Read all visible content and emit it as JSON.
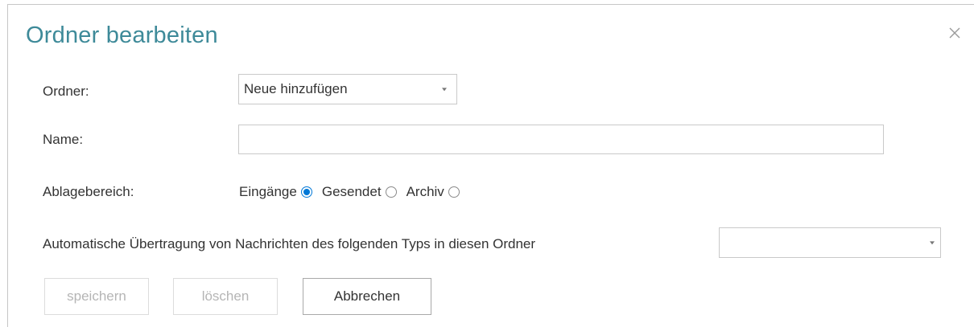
{
  "dialog": {
    "title": "Ordner bearbeiten",
    "close_icon": "close-icon"
  },
  "form": {
    "folder_label": "Ordner:",
    "folder_value": "Neue hinzufügen",
    "name_label": "Name:",
    "name_value": "",
    "area_label": "Ablagebereich:",
    "area_options": [
      {
        "label": "Eingänge",
        "checked": true
      },
      {
        "label": "Gesendet",
        "checked": false
      },
      {
        "label": "Archiv",
        "checked": false
      }
    ],
    "auto_transfer_label": "Automatische Übertragung von Nachrichten des folgenden Typs in diesen Ordner",
    "auto_transfer_value": ""
  },
  "buttons": {
    "save": {
      "label": "speichern",
      "enabled": false
    },
    "delete": {
      "label": "löschen",
      "enabled": false
    },
    "cancel": {
      "label": "Abbrechen",
      "enabled": true
    }
  },
  "colors": {
    "title": "#3e8a99",
    "radio_accent": "#0078d7",
    "disabled_text": "#b5b5b5"
  }
}
